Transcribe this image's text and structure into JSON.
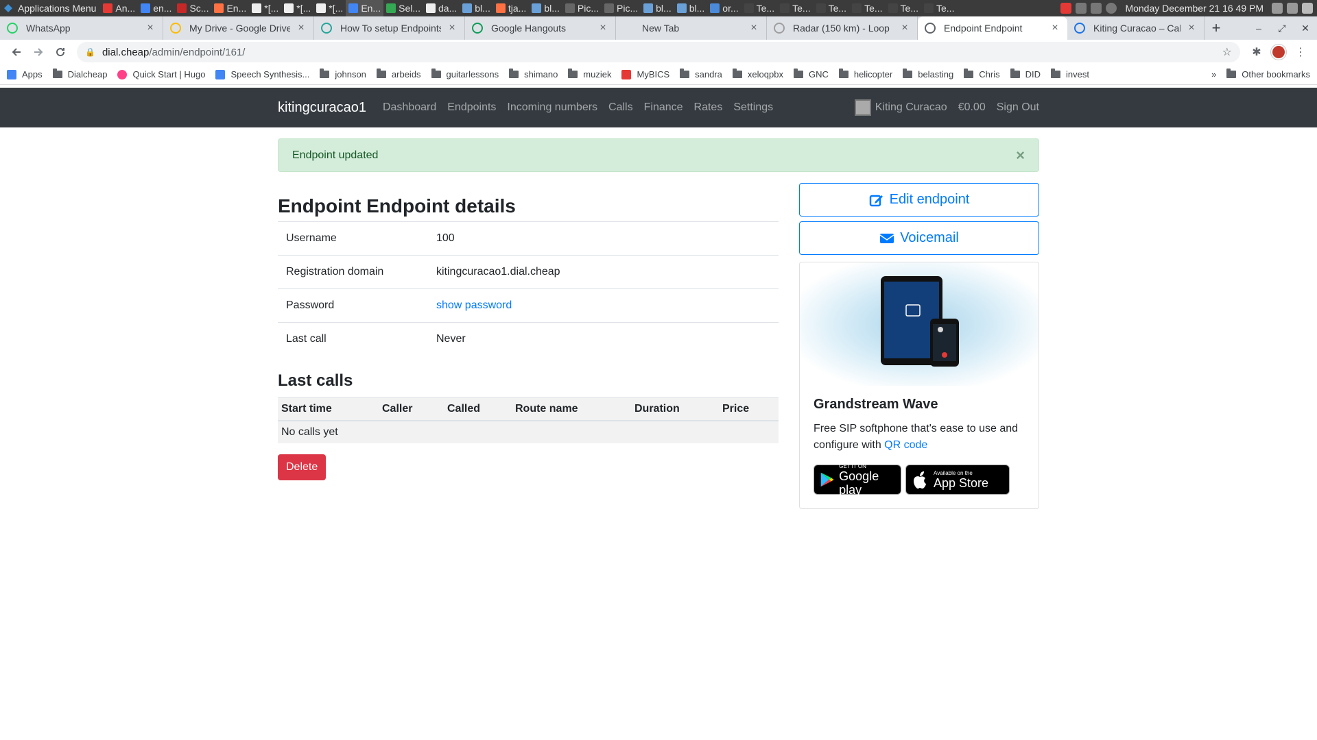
{
  "taskbar": {
    "apps_menu": "Applications Menu",
    "items": [
      "An...",
      "en...",
      "Sc...",
      "En...",
      "*[...",
      "*[...",
      "*[...",
      "En...",
      "Sel...",
      "da...",
      "bl...",
      "tja...",
      "bl...",
      "Pic...",
      "Pic...",
      "bl...",
      "bl...",
      "or...",
      "Te...",
      "Te...",
      "Te...",
      "Te...",
      "Te...",
      "Te..."
    ],
    "clock": "Monday December 21  16 49 PM"
  },
  "tabs": [
    {
      "title": "WhatsApp",
      "color": "#25d366"
    },
    {
      "title": "My Drive - Google Drive",
      "color": "#fbbc04"
    },
    {
      "title": "How To setup Endpoints",
      "color": "#26a69a"
    },
    {
      "title": "Google Hangouts",
      "color": "#0f9d58"
    },
    {
      "title": "New Tab",
      "color": ""
    },
    {
      "title": "Radar (150 km) - Loop",
      "color": "#9e9e9e"
    },
    {
      "title": "Endpoint Endpoint",
      "color": "#5f6368"
    },
    {
      "title": "Kiting Curacao – Calendar",
      "color": "#1a73e8"
    }
  ],
  "url": {
    "host": "dial.cheap",
    "path": "/admin/endpoint/161/"
  },
  "bookmarks": {
    "items": [
      "Apps",
      "Dialcheap",
      "Quick Start | Hugo",
      "Speech Synthesis...",
      "johnson",
      "arbeids",
      "guitarlessons",
      "shimano",
      "muziek",
      "MyBICS",
      "sandra",
      "xeloqpbx",
      "GNC",
      "helicopter",
      "belasting",
      "Chris",
      "DID",
      "invest"
    ],
    "more": "»",
    "other": "Other bookmarks"
  },
  "navbar": {
    "brand": "kitingcuracao1",
    "links": [
      "Dashboard",
      "Endpoints",
      "Incoming numbers",
      "Calls",
      "Finance",
      "Rates",
      "Settings"
    ],
    "account": "Kiting Curacao",
    "balance": "€0.00",
    "signout": "Sign Out"
  },
  "alert": {
    "message": "Endpoint updated",
    "close": "×"
  },
  "details": {
    "heading": "Endpoint Endpoint details",
    "rows": [
      {
        "label": "Username",
        "value": "100"
      },
      {
        "label": "Registration domain",
        "value": "kitingcuracao1.dial.cheap"
      },
      {
        "label": "Password",
        "value": "show password"
      },
      {
        "label": "Last call",
        "value": "Never"
      }
    ]
  },
  "last_calls": {
    "heading": "Last calls",
    "columns": [
      "Start time",
      "Caller",
      "Called",
      "Route name",
      "Duration",
      "Price"
    ],
    "empty": "No calls yet"
  },
  "actions": {
    "delete": "Delete",
    "edit": "Edit endpoint",
    "voicemail": "Voicemail"
  },
  "promo": {
    "title": "Grandstream Wave",
    "text": "Free SIP softphone that's ease to use and configure with ",
    "link": "QR code",
    "google_small": "GET IT ON",
    "google_big": "Google play",
    "apple_small": "Available on the",
    "apple_big": "App Store"
  }
}
